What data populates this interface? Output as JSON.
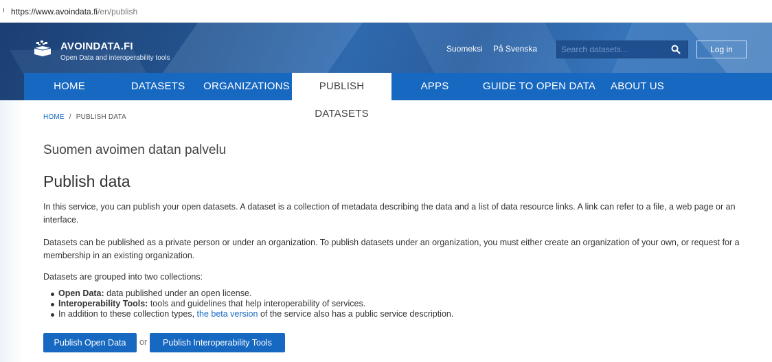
{
  "browser": {
    "url_host": "https://www.avoindata.fi",
    "url_path": "/en/publish"
  },
  "header": {
    "brand": "AVOINDATA.FI",
    "tagline": "Open Data and interoperability tools",
    "lang_fi": "Suomeksi",
    "lang_sv": "På Svenska",
    "search_placeholder": "Search datasets...",
    "login": "Log in"
  },
  "nav": {
    "items": [
      {
        "label": "HOME"
      },
      {
        "label": "DATASETS"
      },
      {
        "label": "ORGANIZATIONS"
      },
      {
        "label": "PUBLISH DATASETS"
      },
      {
        "label": "APPS"
      },
      {
        "label": "GUIDE TO OPEN DATA"
      },
      {
        "label": "ABOUT US"
      }
    ],
    "active": "PUBLISH DATASETS"
  },
  "breadcrumb": {
    "home": "HOME",
    "sep": "/",
    "current": "PUBLISH DATA"
  },
  "main": {
    "subtitle": "Suomen avoimen datan palvelu",
    "title": "Publish data",
    "p1": "In this service, you can publish your open datasets. A dataset is a collection of metadata describing the data and a list of data resource links. A link can refer to a file, a web page or an interface.",
    "p2": "Datasets can be published as a private person or under an organization. To publish datasets under an organization, you must either create an organization of your own, or request for a membership in an existing organization.",
    "p3": "Datasets are grouped into two collections:",
    "list": {
      "item1_bold": "Open Data:",
      "item1_text": " data published under an open license.",
      "item2_bold": "Interoperability Tools:",
      "item2_text": " tools and guidelines that help interoperability of services.",
      "item3_pre": "In addition to these collection types, ",
      "item3_link": "the beta version",
      "item3_post": " of the service also has a public service description."
    },
    "btn_open_data": "Publish Open Data",
    "or": "or",
    "btn_interop": "Publish Interoperability Tools"
  },
  "colors": {
    "nav_blue": "#1768c1",
    "hero_dark": "#1c3f73",
    "link": "#1768c1"
  }
}
